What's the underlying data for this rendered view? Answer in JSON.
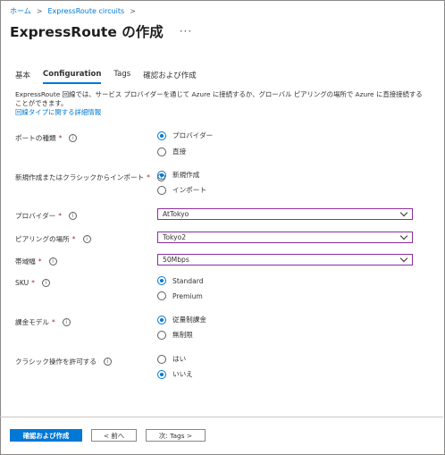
{
  "breadcrumb": {
    "home": "ホーム",
    "circuits": "ExpressRoute circuits"
  },
  "title": "ExpressRoute の作成",
  "tabs": [
    "基本",
    "Configuration",
    "Tags",
    "確認および作成"
  ],
  "description": {
    "text": "ExpressRoute 回線では、サービス プロバイダーを通じて Azure に接続するか、グローバル ピアリングの場所で Azure に直接接続することができます。",
    "link": "回線タイプに関する詳細情報"
  },
  "fields": {
    "port_type": {
      "label": "ポートの種類",
      "options": [
        "プロバイダー",
        "直接"
      ],
      "selected": 0
    },
    "create_or_import": {
      "label": "新規作成またはクラシックからインポート",
      "options": [
        "新規作成",
        "インポート"
      ],
      "selected": 0
    },
    "provider": {
      "label": "プロバイダー",
      "value": "AtTokyo"
    },
    "peering_location": {
      "label": "ピアリングの場所",
      "value": "Tokyo2"
    },
    "bandwidth": {
      "label": "帯域幅",
      "value": "50Mbps"
    },
    "sku": {
      "label": "SKU",
      "options": [
        "Standard",
        "Premium"
      ],
      "selected": 0
    },
    "billing_model": {
      "label": "課金モデル",
      "options": [
        "従量制課金",
        "無制限"
      ],
      "selected": 0
    },
    "classic_ops": {
      "label": "クラシック操作を許可する",
      "options": [
        "はい",
        "いいえ"
      ],
      "selected": 1
    }
  },
  "buttons": {
    "review_create": "確認および作成",
    "previous": "< 前へ",
    "next": "次: Tags >"
  },
  "colors": {
    "accent": "#0078d4",
    "required": "#a4262c",
    "select_border": "#8a2f9c"
  }
}
